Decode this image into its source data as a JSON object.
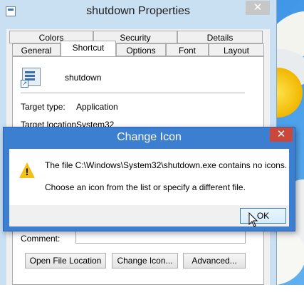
{
  "properties_window": {
    "title": "shutdown Properties",
    "close_glyph": "✕",
    "tabs_row1": [
      "Colors",
      "Security",
      "Details"
    ],
    "tabs_row2": [
      "General",
      "Shortcut",
      "Options",
      "Font",
      "Layout"
    ],
    "active_tab": "Shortcut",
    "app_name": "shutdown",
    "fields": [
      {
        "label": "Target type:",
        "value": "Application"
      },
      {
        "label": "Target location:",
        "value": "System32"
      }
    ],
    "comment_label": "Comment:",
    "comment_value": "",
    "buttons": [
      "Open File Location",
      "Change Icon...",
      "Advanced..."
    ]
  },
  "change_icon_dialog": {
    "title": "Change Icon",
    "close_glyph": "✕",
    "icon": "warning-icon",
    "message_line1": "The file C:\\Windows\\System32\\shutdown.exe contains no icons.",
    "message_line2": "Choose an icon from the list or specify a different file.",
    "ok_label": "OK"
  },
  "colors": {
    "dialog_frame": "#3c7ed0",
    "close_red": "#c9473b",
    "window_frame": "#c9dff2"
  }
}
